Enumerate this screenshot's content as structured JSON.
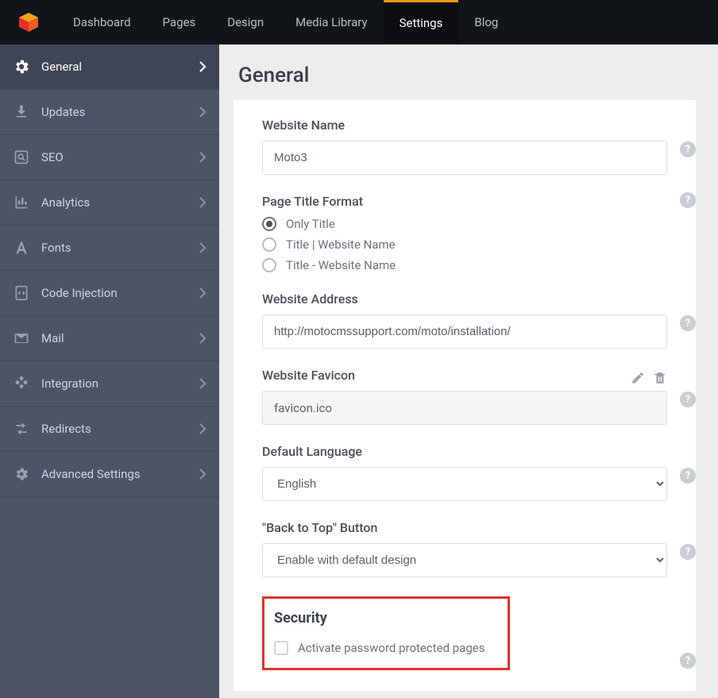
{
  "topnav": {
    "items": [
      "Dashboard",
      "Pages",
      "Design",
      "Media Library",
      "Settings",
      "Blog"
    ],
    "active": 4
  },
  "sidebar": {
    "items": [
      {
        "label": "General",
        "icon": "gear-icon"
      },
      {
        "label": "Updates",
        "icon": "download-icon"
      },
      {
        "label": "SEO",
        "icon": "search-doc-icon"
      },
      {
        "label": "Analytics",
        "icon": "bar-chart-icon"
      },
      {
        "label": "Fonts",
        "icon": "font-icon"
      },
      {
        "label": "Code Injection",
        "icon": "code-doc-icon"
      },
      {
        "label": "Mail",
        "icon": "mail-icon"
      },
      {
        "label": "Integration",
        "icon": "integration-icon"
      },
      {
        "label": "Redirects",
        "icon": "redirect-icon"
      },
      {
        "label": "Advanced Settings",
        "icon": "sliders-icon"
      }
    ],
    "active": 0
  },
  "page": {
    "title": "General",
    "website_name_label": "Website Name",
    "website_name_value": "Moto3",
    "ptf_label": "Page Title Format",
    "ptf_options": [
      "Only Title",
      "Title | Website Name",
      "Title - Website Name"
    ],
    "ptf_selected": 0,
    "website_address_label": "Website Address",
    "website_address_value": "http://motocmssupport.com/moto/installation/",
    "favicon_label": "Website Favicon",
    "favicon_value": "favicon.ico",
    "default_language_label": "Default Language",
    "default_language_value": "English",
    "back_to_top_label": "\"Back to Top\" Button",
    "back_to_top_value": "Enable with default design",
    "security_title": "Security",
    "activate_label": "Activate password protected pages"
  }
}
